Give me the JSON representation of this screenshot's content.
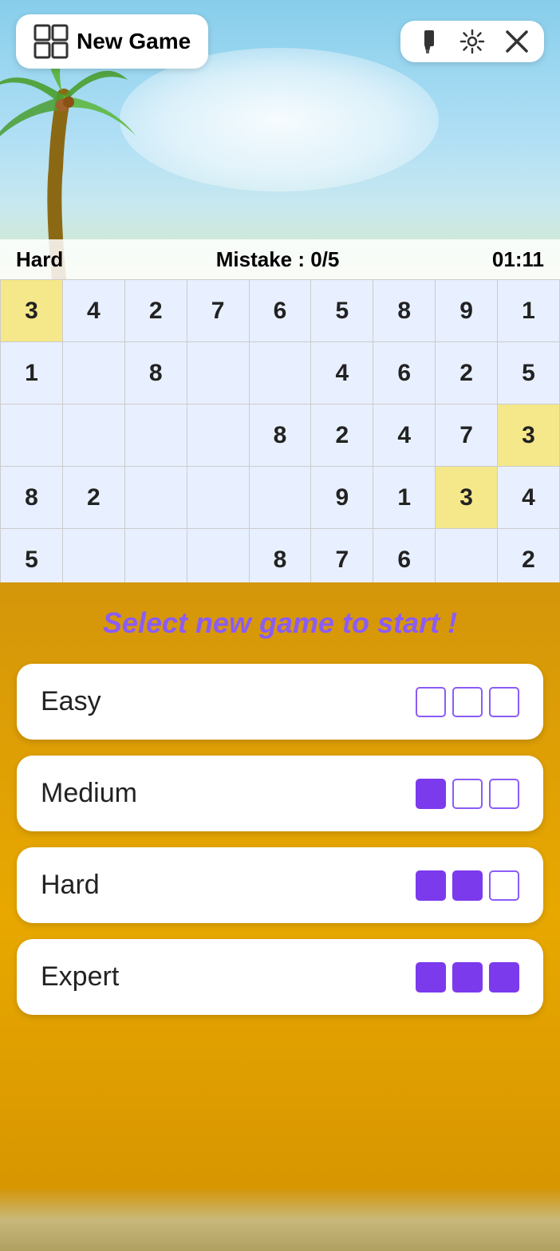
{
  "header": {
    "new_game_label": "New Game",
    "paint_icon": "🖌",
    "settings_icon": "⚙",
    "close_icon": "✕"
  },
  "status": {
    "difficulty": "Hard",
    "mistake_label": "Mistake : 0/5",
    "timer": "01:11"
  },
  "grid": {
    "rows": [
      [
        "3",
        "4",
        "2",
        "7",
        "6",
        "5",
        "8",
        "9",
        "1"
      ],
      [
        "1",
        "",
        "8",
        "",
        "",
        "4",
        "6",
        "2",
        "5"
      ],
      [
        "",
        "",
        "",
        "",
        "8",
        "2",
        "4",
        "7",
        "3"
      ],
      [
        "8",
        "2",
        "",
        "",
        "",
        "9",
        "1",
        "3",
        "4"
      ],
      [
        "5",
        "",
        "",
        "",
        "8",
        "7",
        "6",
        "",
        "2"
      ]
    ],
    "highlighted_cells": [
      [
        0,
        0
      ],
      [
        2,
        8
      ],
      [
        3,
        7
      ]
    ],
    "blue_cells": "most cells"
  },
  "overlay": {
    "title": "Select new game to start !",
    "difficulties": [
      {
        "label": "Easy",
        "stars": [
          false,
          false,
          false
        ]
      },
      {
        "label": "Medium",
        "stars": [
          true,
          false,
          false
        ]
      },
      {
        "label": "Hard",
        "stars": [
          true,
          true,
          false
        ]
      },
      {
        "label": "Expert",
        "stars": [
          true,
          true,
          true
        ]
      }
    ]
  }
}
